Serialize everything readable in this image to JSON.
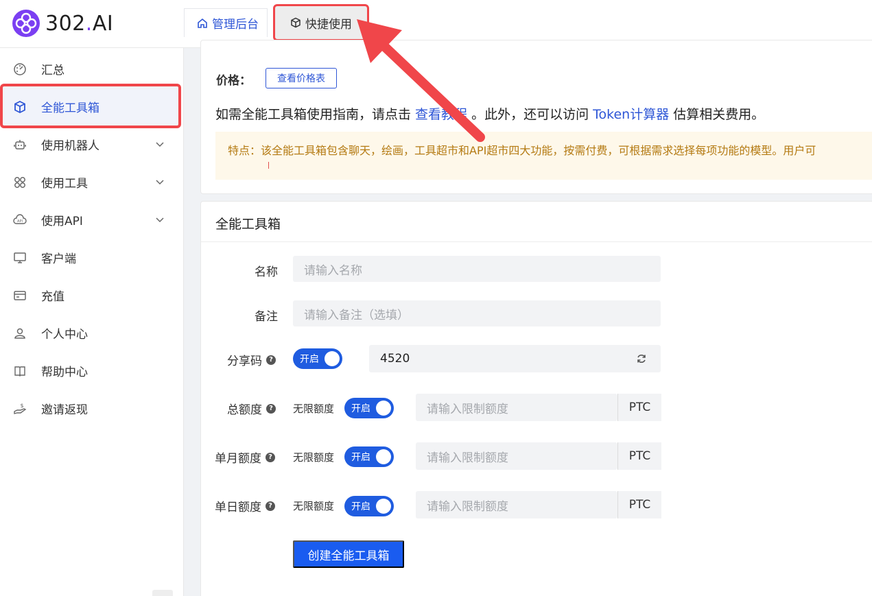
{
  "brand": {
    "name_main": "302",
    "name_dot": ".",
    "name_suffix": "AI"
  },
  "tabs": [
    {
      "label": "管理后台"
    },
    {
      "label": "快捷使用"
    }
  ],
  "sidebar": {
    "items": [
      {
        "label": "汇总"
      },
      {
        "label": "全能工具箱"
      },
      {
        "label": "使用机器人"
      },
      {
        "label": "使用工具"
      },
      {
        "label": "使用API"
      },
      {
        "label": "客户端"
      },
      {
        "label": "充值"
      },
      {
        "label": "个人中心"
      },
      {
        "label": "帮助中心"
      },
      {
        "label": "邀请返现"
      }
    ]
  },
  "info": {
    "price_label": "价格：",
    "price_button": "查看价格表",
    "guide_prefix": "如需全能工具箱使用指南，请点击 ",
    "guide_link1": "查看教程",
    "guide_middle": " 。此外，还可以访问 ",
    "guide_link2": "Token计算器",
    "guide_suffix": " 估算相关费用。",
    "notice": "特点：该全能工具箱包含聊天，绘画，工具超市和API超市四大功能，按需付费，可根据需求选择每项功能的模型。用户可"
  },
  "form": {
    "title": "全能工具箱",
    "name_label": "名称",
    "name_placeholder": "请输入名称",
    "note_label": "备注",
    "note_placeholder": "请输入备注（选填）",
    "share_label": "分享码",
    "share_switch": "开启",
    "share_code": "4520",
    "total_label": "总额度",
    "monthly_label": "单月额度",
    "daily_label": "单日额度",
    "unlimited_label": "无限额度",
    "switch_on": "开启",
    "limit_placeholder": "请输入限制额度",
    "unit": "PTC",
    "create_button": "创建全能工具箱"
  },
  "colors": {
    "accent": "#1f5ce0",
    "highlight": "#f0464a",
    "notice_bg": "#fef8ea",
    "notice_text": "#b47a12"
  }
}
